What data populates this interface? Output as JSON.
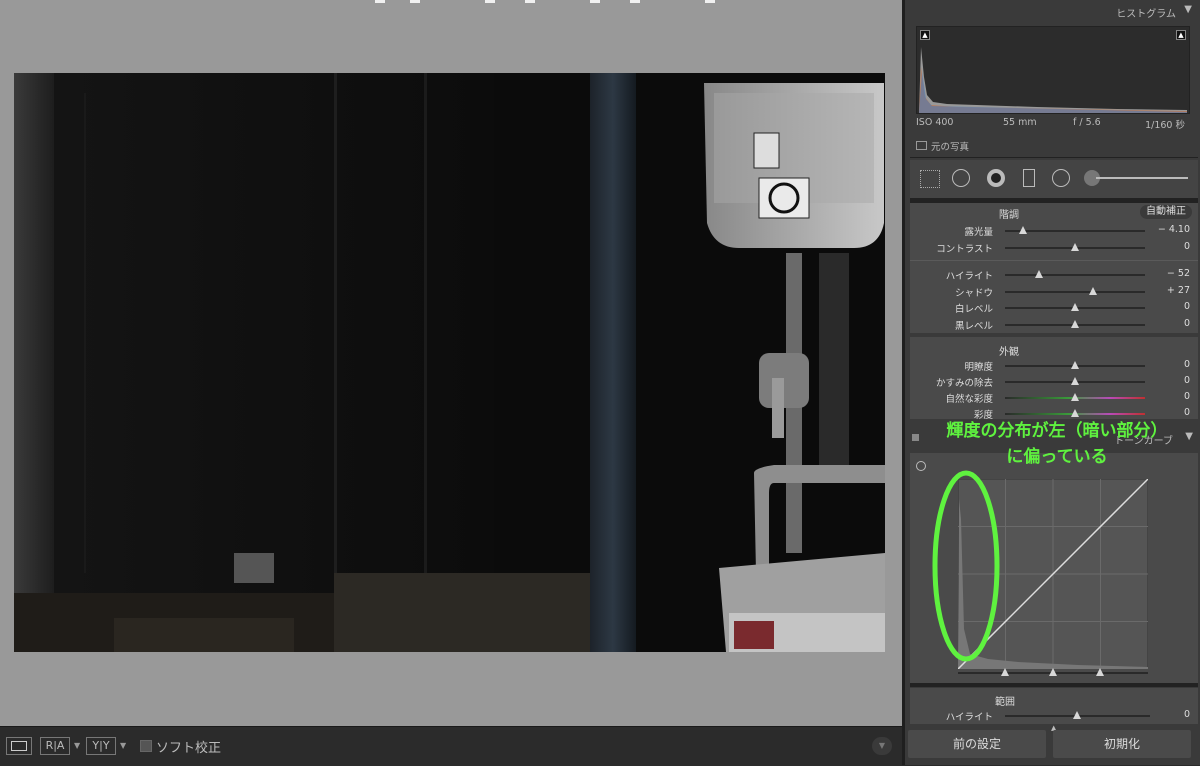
{
  "viewer": {
    "view_mode_label": "",
    "compare_a_label": "R|A",
    "compare_b_label": "Y|Y",
    "soft_proof_label": "ソフト校正"
  },
  "histogram": {
    "title": "ヒストグラム",
    "iso": "ISO 400",
    "focal_length": "55 mm",
    "aperture": "f / 5.6",
    "shutter": "1/160 秒",
    "original_photo_label": "元の写真"
  },
  "basic": {
    "tone_label": "階調",
    "auto_label": "自動補正",
    "sliders": [
      {
        "label": "露光量",
        "value": "− 4.10",
        "pos": 0.13
      },
      {
        "label": "コントラスト",
        "value": "0",
        "pos": 0.5
      },
      {
        "label": "ハイライト",
        "value": "− 52",
        "pos": 0.24
      },
      {
        "label": "シャドウ",
        "value": "+ 27",
        "pos": 0.63
      },
      {
        "label": "白レベル",
        "value": "0",
        "pos": 0.5
      },
      {
        "label": "黒レベル",
        "value": "0",
        "pos": 0.5
      }
    ],
    "presence_label": "外観",
    "presence_sliders": [
      {
        "label": "明瞭度",
        "value": "0",
        "pos": 0.5
      },
      {
        "label": "かすみの除去",
        "value": "0",
        "pos": 0.5
      },
      {
        "label": "自然な彩度",
        "value": "0",
        "pos": 0.5
      },
      {
        "label": "彩度",
        "value": "0",
        "pos": 0.5
      }
    ]
  },
  "tone_curve": {
    "title": "トーンカーブ",
    "range_label": "範囲",
    "highlight_label": "ハイライト",
    "highlight_value": "0"
  },
  "buttons": {
    "previous": "前の設定",
    "reset": "初期化"
  },
  "annotation": {
    "line1": "輝度の分布が左（暗い部分）",
    "line2": "に偏っている"
  },
  "colors": {
    "annotation": "#5ff23f"
  }
}
